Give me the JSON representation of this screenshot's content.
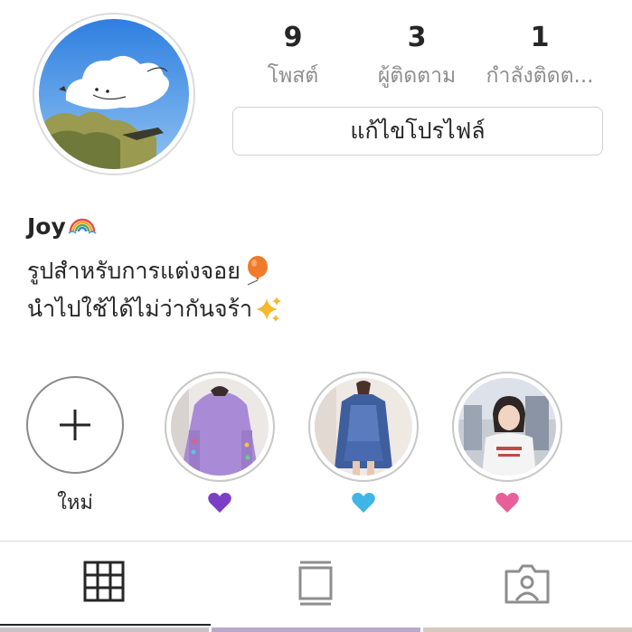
{
  "profile": {
    "name": "Joy",
    "bio_line1": "รูปสำหรับการแต่งจอย",
    "bio_line2": "นำไปใช้ได้ไม่ว่ากันจร้า",
    "stats": [
      {
        "value": "9",
        "label": "โพสต์"
      },
      {
        "value": "3",
        "label": "ผู้ติดตาม"
      },
      {
        "value": "1",
        "label": "กำลังติดต..."
      }
    ],
    "edit_label": "แก้ไขโปรไฟล์"
  },
  "highlights": {
    "new_label": "ใหม่",
    "items": [
      {
        "heart_color": "#7b3fc6"
      },
      {
        "heart_color": "#3fb6e6"
      },
      {
        "heart_color": "#e8609a"
      }
    ]
  },
  "tabs": [
    "grid-icon",
    "feed-icon",
    "tagged-icon"
  ],
  "colors": {
    "text": "#262626",
    "muted": "#8e8e8e",
    "border": "#dbdbdb"
  }
}
